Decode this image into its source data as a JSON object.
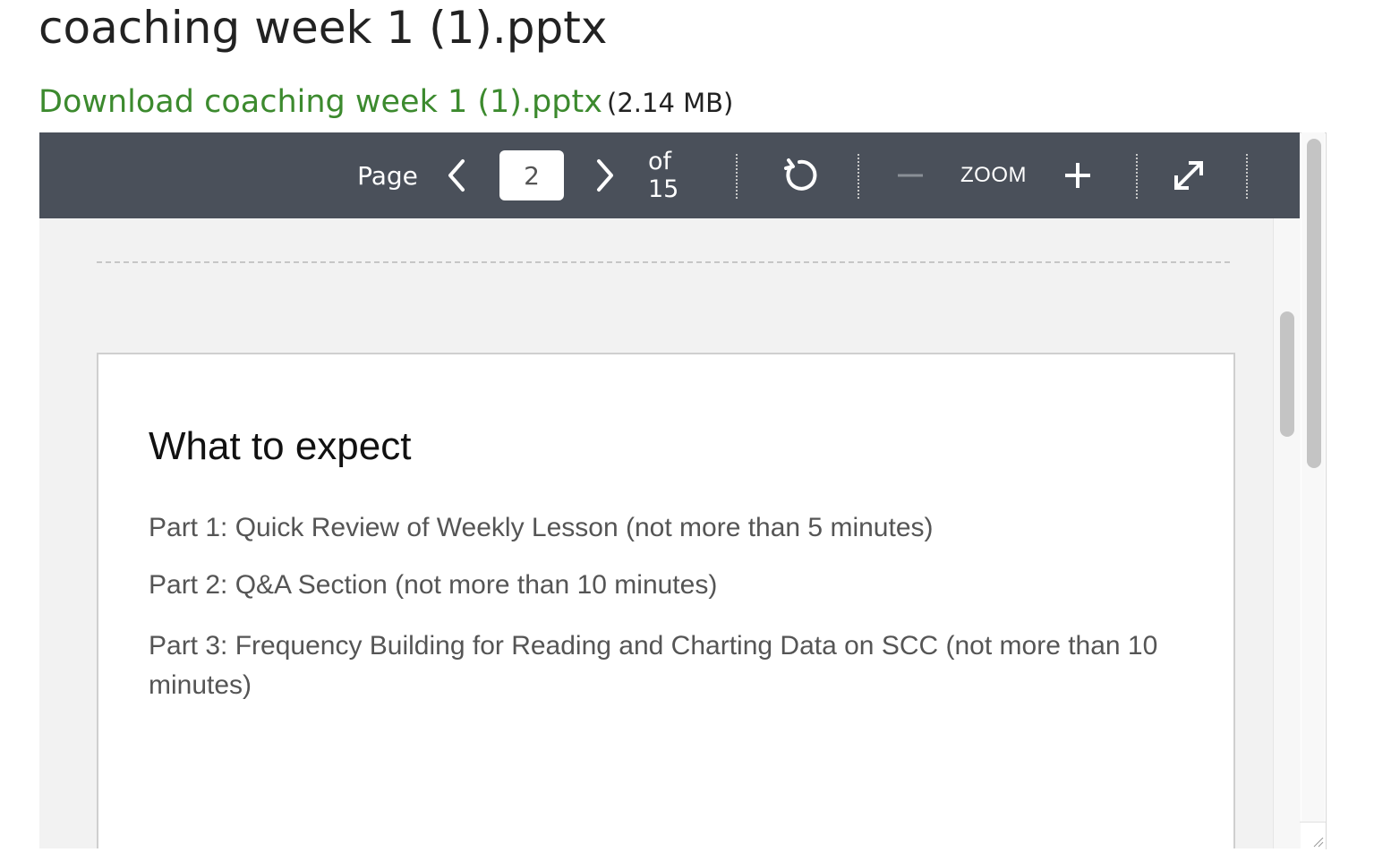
{
  "page": {
    "title": "coaching week 1 (1).pptx",
    "download_label": "Download coaching week 1 (1).pptx",
    "file_size": "(2.14 MB)"
  },
  "toolbar": {
    "page_label": "Page",
    "current_page": "2",
    "of_label": "of 15",
    "zoom_label": "ZOOM",
    "prev_icon": "chevron-left-icon",
    "next_icon": "chevron-right-icon",
    "rotate_icon": "rotate-icon",
    "zoom_out_icon": "minus-icon",
    "zoom_in_icon": "plus-icon",
    "fullscreen_icon": "expand-icon"
  },
  "slide": {
    "title": "What to expect",
    "lines": [
      "Part 1: Quick Review of Weekly Lesson (not more than 5 minutes)",
      "Part 2: Q&A Section (not more than 10 minutes)",
      "Part 3: Frequency Building for Reading and Charting Data on SCC (not more than 10 minutes)"
    ]
  },
  "colors": {
    "link_green": "#3c8a2e",
    "toolbar_bg": "#4a505a",
    "viewer_bg": "#f2f2f2",
    "slide_text": "#555555"
  }
}
